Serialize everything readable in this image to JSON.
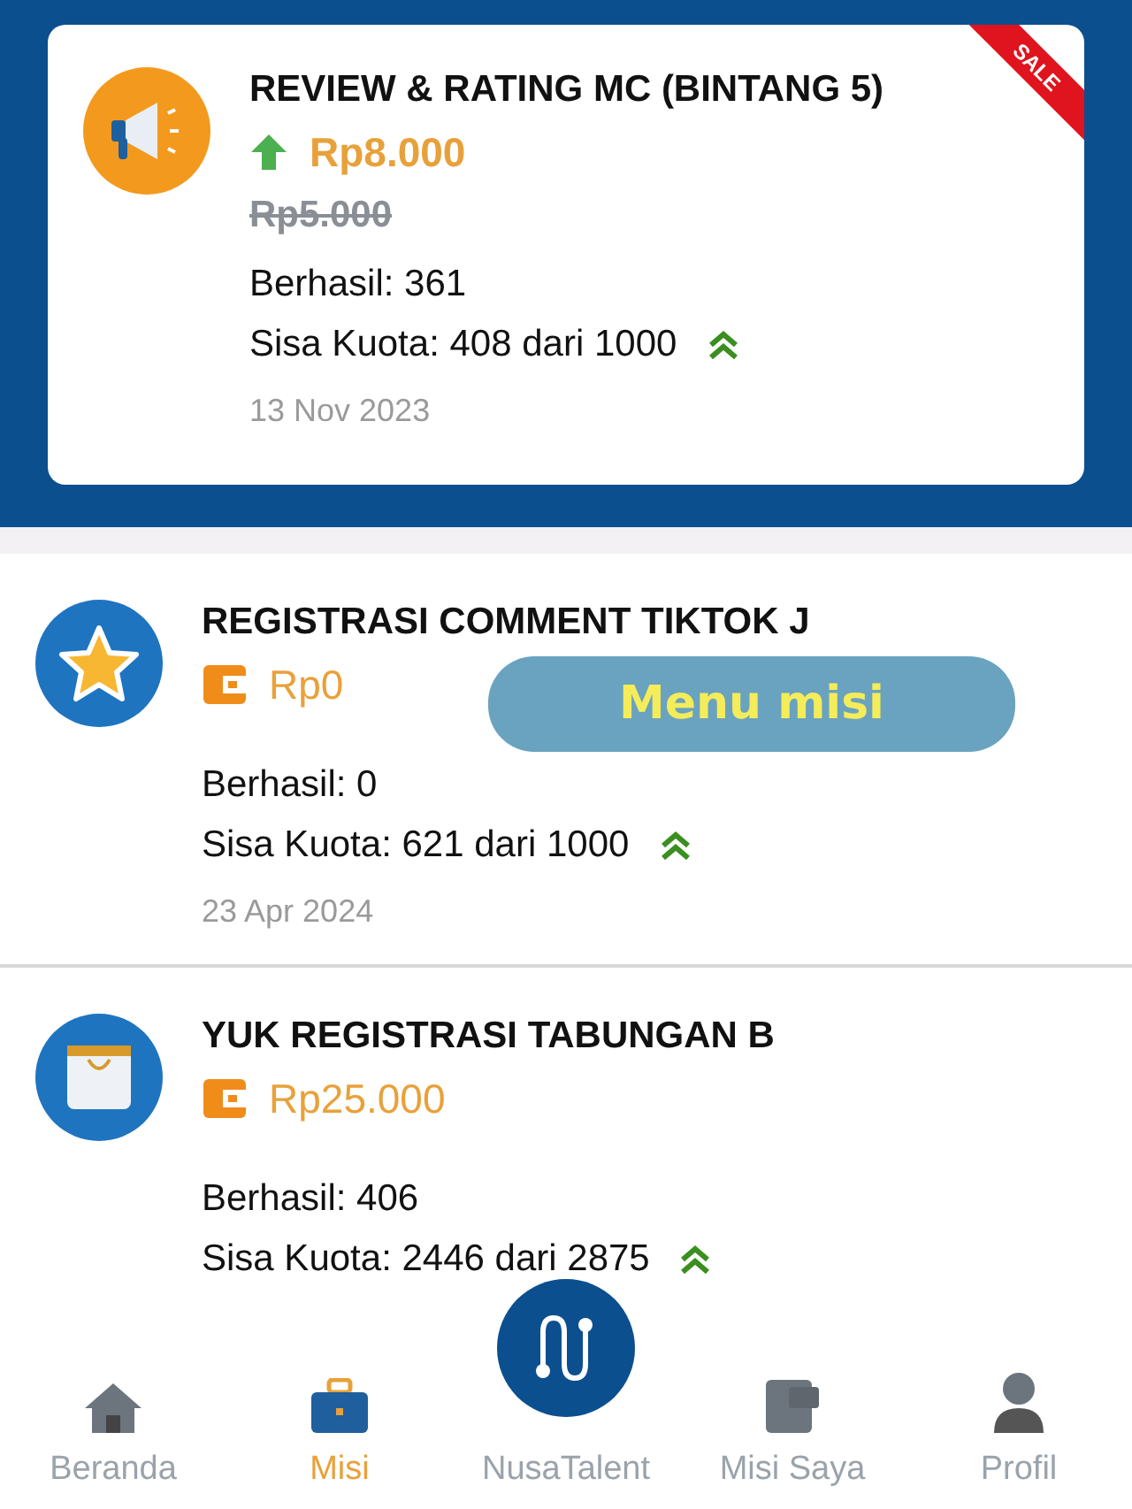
{
  "missions": [
    {
      "kind": "megaphone",
      "featured": true,
      "badge": "SALE",
      "title": "REVIEW & RATING MC (BINTANG 5)",
      "price": "Rp8.000",
      "old_price": "Rp5.000",
      "success": "Berhasil: 361",
      "quota": "Sisa Kuota: 408 dari 1000",
      "date": "13 Nov 2023"
    },
    {
      "kind": "star",
      "featured": false,
      "title": "REGISTRASI COMMENT TIKTOK J",
      "price": "Rp0",
      "success": "Berhasil: 0",
      "quota": "Sisa Kuota: 621 dari 1000",
      "date": "23 Apr 2024"
    },
    {
      "kind": "bag",
      "featured": false,
      "title": "YUK REGISTRASI TABUNGAN B",
      "price": "Rp25.000",
      "success": "Berhasil: 406",
      "quota": "Sisa Kuota: 2446 dari 2875"
    }
  ],
  "annotation": "Menu misi",
  "nav": [
    {
      "kind": "home",
      "label": "Beranda",
      "selected": false
    },
    {
      "kind": "briefcase",
      "label": "Misi",
      "selected": true
    },
    {
      "kind": "fab",
      "label": "NusaTalent",
      "selected": false
    },
    {
      "kind": "folder",
      "label": "Misi Saya",
      "selected": false
    },
    {
      "kind": "person",
      "label": "Profil",
      "selected": false
    }
  ]
}
